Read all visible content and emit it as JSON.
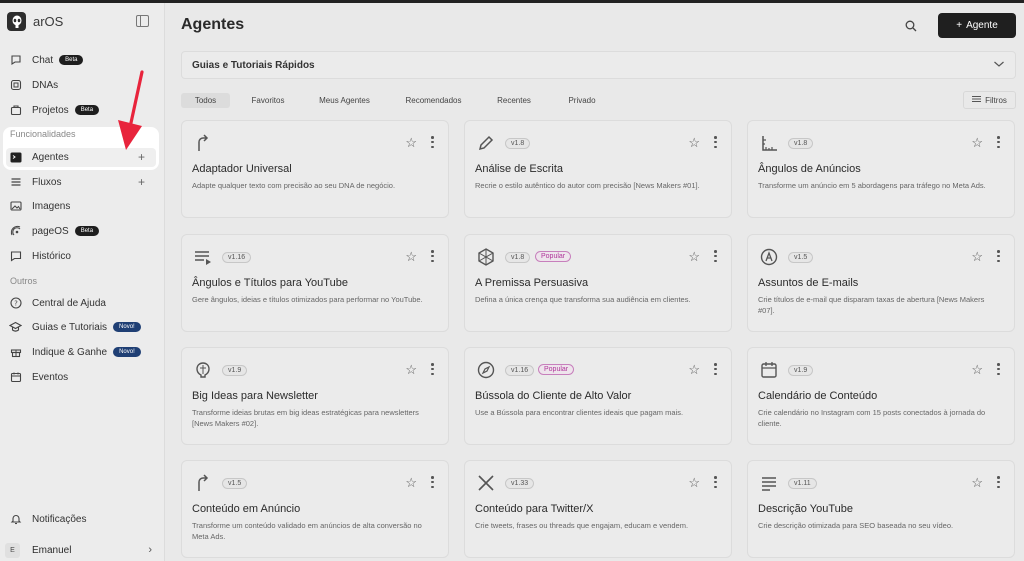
{
  "app": {
    "name": "arOS"
  },
  "sidebar": {
    "items": [
      {
        "label": "Chat",
        "badge": "Beta"
      },
      {
        "label": "DNAs"
      },
      {
        "label": "Projetos",
        "badge": "Beta"
      }
    ],
    "sections": {
      "features": "Funcionalidades",
      "others": "Outros"
    },
    "features": [
      {
        "label": "Agentes"
      },
      {
        "label": "Fluxos"
      },
      {
        "label": "Imagens"
      },
      {
        "label": "pageOS",
        "badge": "Beta"
      },
      {
        "label": "Histórico"
      }
    ],
    "others": [
      {
        "label": "Central de Ajuda"
      },
      {
        "label": "Guias e Tutoriais",
        "badge": "Novo!"
      },
      {
        "label": "Indique & Ganhe",
        "badge": "Novo!"
      },
      {
        "label": "Eventos"
      }
    ],
    "notifications": "Notificações",
    "user": {
      "initial": "E",
      "name": "Emanuel"
    }
  },
  "header": {
    "title": "Agentes",
    "new_button": "Agente"
  },
  "guides": {
    "label": "Guias e Tutoriais Rápidos"
  },
  "tabs": [
    "Todos",
    "Favoritos",
    "Meus Agentes",
    "Recomendados",
    "Recentes",
    "Privado"
  ],
  "filters_label": "Filtros",
  "cards": [
    {
      "title": "Adaptador Universal",
      "version": "",
      "popular": "",
      "desc": "Adapte qualquer texto com precisão ao seu DNA de negócio.",
      "icon": "redo-arrow-icon"
    },
    {
      "title": "Análise de Escrita",
      "version": "v1.8",
      "popular": "",
      "desc": "Recrie o estilo autêntico do autor com precisão [News Makers #01].",
      "icon": "pen-icon"
    },
    {
      "title": "Ângulos de Anúncios",
      "version": "v1.8",
      "popular": "",
      "desc": "Transforme um anúncio em 5 abordagens para tráfego no Meta Ads.",
      "icon": "angle-ruler-icon"
    },
    {
      "title": "Ângulos e Títulos para YouTube",
      "version": "v1.16",
      "popular": "",
      "desc": "Gere ângulos, ideias e títulos otimizados para performar no YouTube.",
      "icon": "list-play-icon"
    },
    {
      "title": "A Premissa Persuasiva",
      "version": "v1.8",
      "popular": "Popular",
      "desc": "Defina a única crença que transforma sua audiência em clientes.",
      "icon": "network-icon"
    },
    {
      "title": "Assuntos de E-mails",
      "version": "v1.5",
      "popular": "",
      "desc": "Crie títulos de e-mail que disparam taxas de abertura [News Makers #07].",
      "icon": "at-sign-icon"
    },
    {
      "title": "Big Ideas para Newsletter",
      "version": "v1.9",
      "popular": "",
      "desc": "Transforme ideias brutas em big ideas estratégicas para newsletters [News Makers #02].",
      "icon": "brain-icon"
    },
    {
      "title": "Bússola do Cliente de Alto Valor",
      "version": "v1.16",
      "popular": "Popular",
      "desc": "Use a Bússola para encontrar clientes ideais que pagam mais.",
      "icon": "compass-icon"
    },
    {
      "title": "Calendário de Conteúdo",
      "version": "v1.9",
      "popular": "",
      "desc": "Crie calendário no Instagram com 15 posts conectados à jornada do cliente.",
      "icon": "calendar-icon"
    },
    {
      "title": "Conteúdo em Anúncio",
      "version": "v1.5",
      "popular": "",
      "desc": "Transforme um conteúdo validado em anúncios de alta conversão no Meta Ads.",
      "icon": "redo-arrow-icon"
    },
    {
      "title": "Conteúdo para Twitter/X",
      "version": "v1.33",
      "popular": "",
      "desc": "Crie tweets, frases ou threads que engajam, educam e vendem.",
      "icon": "x-logo-icon"
    },
    {
      "title": "Descrição YouTube",
      "version": "v1.11",
      "popular": "",
      "desc": "Crie descrição otimizada para SEO baseada no seu vídeo.",
      "icon": "align-left-icon"
    }
  ],
  "colors": {
    "accent": "#1f1f1f",
    "popular": "#b0359a",
    "annotation_arrow": "#e8243c",
    "new_badge": "#1f3f74"
  }
}
